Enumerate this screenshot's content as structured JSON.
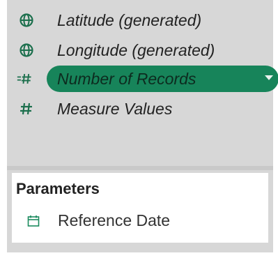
{
  "measures": {
    "items": [
      {
        "label": "Latitude (generated)",
        "icon": "globe-icon"
      },
      {
        "label": "Longitude (generated)",
        "icon": "globe-icon"
      },
      {
        "label": "Number of Records",
        "icon": "measure-hash-icon",
        "selected": true
      },
      {
        "label": "Measure Values",
        "icon": "hash-icon"
      }
    ]
  },
  "parameters": {
    "title": "Parameters",
    "items": [
      {
        "label": "Reference Date",
        "icon": "calendar-icon"
      }
    ]
  },
  "colors": {
    "panel_bg": "#d7d7d7",
    "accent_green": "#17845a",
    "icon_green": "#1b6f4c"
  }
}
